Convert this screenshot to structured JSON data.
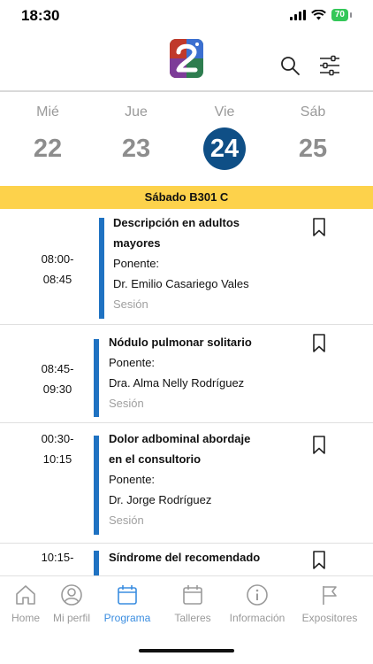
{
  "status_bar": {
    "time": "18:30",
    "battery": "70"
  },
  "days": [
    {
      "name": "Mié",
      "number": "22",
      "selected": false
    },
    {
      "name": "Jue",
      "number": "23",
      "selected": false
    },
    {
      "name": "Vie",
      "number": "24",
      "selected": true
    },
    {
      "name": "Sáb",
      "number": "25",
      "selected": false
    }
  ],
  "room_banner": "Sábado B301 C",
  "sessions": [
    {
      "time_start": "08:00-",
      "time_end": "08:45",
      "title_line1": "Descripción en adultos",
      "title_line2": "mayores",
      "speaker_label": "Ponente:",
      "speaker": "Dr. Emilio Casariego Vales",
      "type": "Sesión"
    },
    {
      "time_start": "08:45-",
      "time_end": "09:30",
      "title_line1": "Nódulo pulmonar solitario",
      "speaker_label": "Ponente:",
      "speaker": "Dra. Alma Nelly Rodríguez",
      "type": "Sesión"
    },
    {
      "time_start": "00:30-",
      "time_end": "10:15",
      "title_line1": "Dolor adbominal abordaje",
      "title_line2": "en el consultorio",
      "speaker_label": "Ponente:",
      "speaker": "Dr. Jorge Rodríguez",
      "type": "Sesión"
    },
    {
      "time_start": "10:15-",
      "title_line1": "Síndrome del recomendado"
    }
  ],
  "nav": [
    {
      "label": "Home",
      "icon": "home-icon"
    },
    {
      "label": "Mi perfil",
      "icon": "profile-icon"
    },
    {
      "label": "Programa",
      "icon": "calendar-icon",
      "active": true
    },
    {
      "label": "Talleres",
      "icon": "calendar-icon"
    },
    {
      "label": "Información",
      "icon": "info-icon"
    },
    {
      "label": "Expositores",
      "icon": "flag-icon"
    }
  ],
  "colors": {
    "accent": "#0f4f86",
    "banner": "#fdd24b",
    "session_bar": "#1f72c2",
    "nav_active": "#3a8de0"
  }
}
